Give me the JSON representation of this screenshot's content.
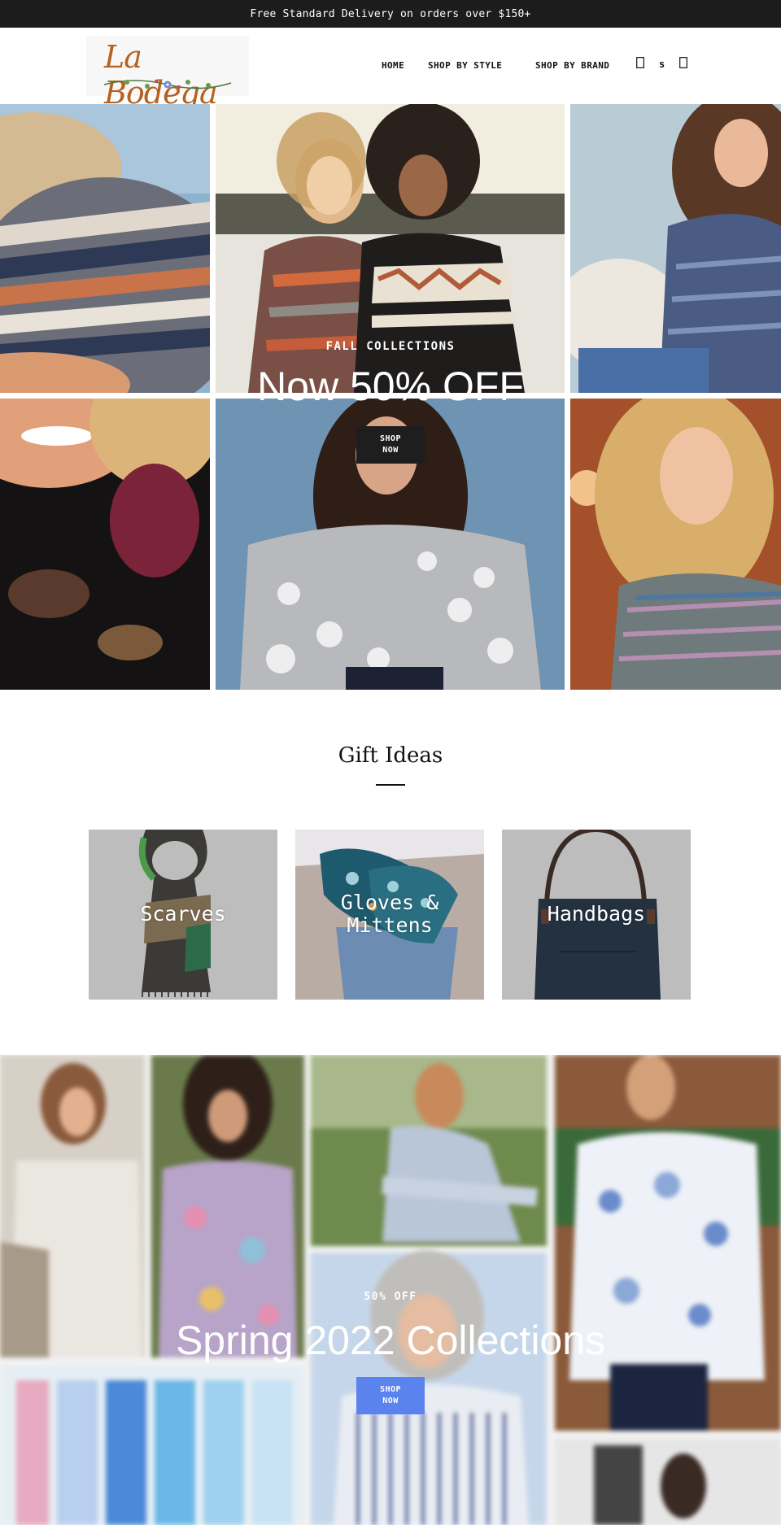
{
  "announcement": {
    "text": "Free Standard Delivery on orders over $150+"
  },
  "header": {
    "logo_text": "La Bodega",
    "nav": {
      "home": "HOME",
      "shop_by_style": "SHOP BY STYLE",
      "shop_by_brand": "SHOP BY BRAND"
    },
    "icons": [
      "account-icon",
      "search-icon",
      "cart-icon"
    ],
    "search_glyph": "s"
  },
  "hero": {
    "eyebrow": "FALL COLLECTIONS",
    "title": "Now 50% OFF",
    "button": "SHOP\nNOW"
  },
  "gift_ideas": {
    "title": "Gift Ideas",
    "cards": [
      {
        "label": "Scarves"
      },
      {
        "label": "Gloves &\nMittens"
      },
      {
        "label": "Handbags"
      }
    ]
  },
  "spring": {
    "eyebrow": "50% OFF",
    "title": "Spring 2022 Collections",
    "button": "SHOP\nNOW"
  },
  "colors": {
    "announcement_bg": "#1c1c1c",
    "logo": "#b5611f",
    "hero_button": "#1e1e1e",
    "spring_button": "#5b83ee",
    "card_bg": "#bdbdbd"
  }
}
